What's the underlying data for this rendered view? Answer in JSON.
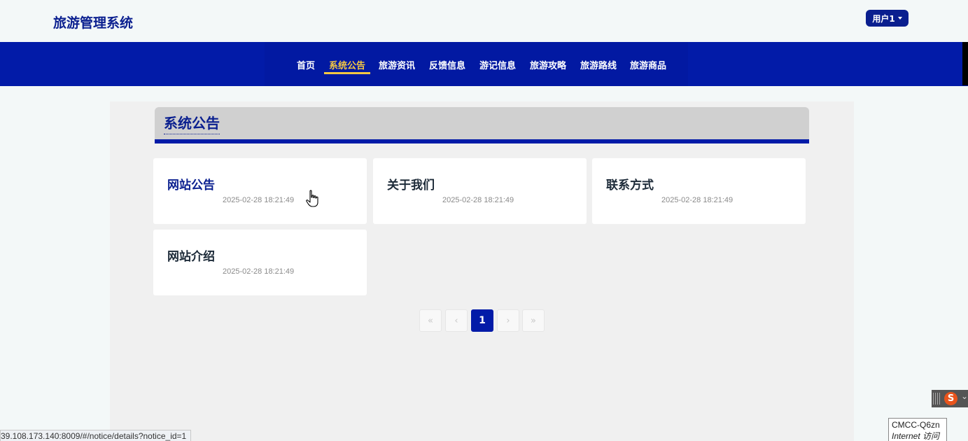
{
  "header": {
    "site_title": "旅游管理系统",
    "user_label": "用户1",
    "user_menu_icon": "caret-down-icon"
  },
  "nav": {
    "items": [
      {
        "label": "首页",
        "active": false
      },
      {
        "label": "系统公告",
        "active": true
      },
      {
        "label": "旅游资讯",
        "active": false
      },
      {
        "label": "反馈信息",
        "active": false
      },
      {
        "label": "游记信息",
        "active": false
      },
      {
        "label": "旅游攻略",
        "active": false
      },
      {
        "label": "旅游路线",
        "active": false
      },
      {
        "label": "旅游商品",
        "active": false
      }
    ],
    "active_color": "#f5c842",
    "bar_color": "#021ba8"
  },
  "section": {
    "title": "系统公告"
  },
  "notices": [
    {
      "title": "网站公告",
      "date": "2025-02-28 18:21:49"
    },
    {
      "title": "关于我们",
      "date": "2025-02-28 18:21:49"
    },
    {
      "title": "联系方式",
      "date": "2025-02-28 18:21:49"
    },
    {
      "title": "网站介绍",
      "date": "2025-02-28 18:21:49"
    }
  ],
  "pagination": {
    "first": "«",
    "prev": "‹",
    "current": "1",
    "next": "›",
    "last": "»"
  },
  "statusbar": {
    "url": "39.108.173.140:8009/#/notice/details?notice_id=1"
  },
  "system": {
    "ime_label": "S",
    "network_name": "CMCC-Q6zn",
    "network_status": "Internet 访问"
  }
}
